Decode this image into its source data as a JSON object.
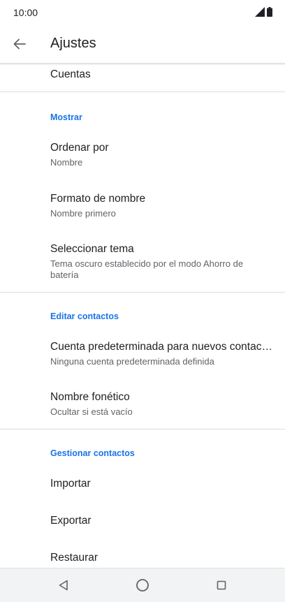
{
  "status_bar": {
    "time": "10:00",
    "icons": [
      "signal-icon",
      "battery-icon"
    ]
  },
  "app_bar": {
    "title": "Ajustes",
    "back_icon": "arrow-left-icon"
  },
  "settings": {
    "accounts": {
      "title": "Cuentas"
    },
    "display": {
      "header": "Mostrar",
      "sort_by": {
        "title": "Ordenar por",
        "value": "Nombre"
      },
      "name_format": {
        "title": "Formato de nombre",
        "value": "Nombre primero"
      },
      "theme": {
        "title": "Seleccionar tema",
        "value": "Tema oscuro establecido por el modo Ahorro de batería"
      }
    },
    "edit_contacts": {
      "header": "Editar contactos",
      "default_account": {
        "title": "Cuenta predeterminada para nuevos contactos",
        "value": "Ninguna cuenta predeterminada definida"
      },
      "phonetic_name": {
        "title": "Nombre fonético",
        "value": "Ocultar si está vacío"
      }
    },
    "manage_contacts": {
      "header": "Gestionar contactos",
      "import": {
        "title": "Importar"
      },
      "export": {
        "title": "Exportar"
      },
      "restore": {
        "title": "Restaurar"
      }
    }
  },
  "nav_bar": {
    "back": "triangle-back-icon",
    "home": "circle-home-icon",
    "recents": "square-recents-icon"
  },
  "colors": {
    "accent": "#1a73e8",
    "text_primary": "#202124",
    "text_secondary": "#5f6368",
    "nav_bar_bg": "#f1f3f4"
  }
}
